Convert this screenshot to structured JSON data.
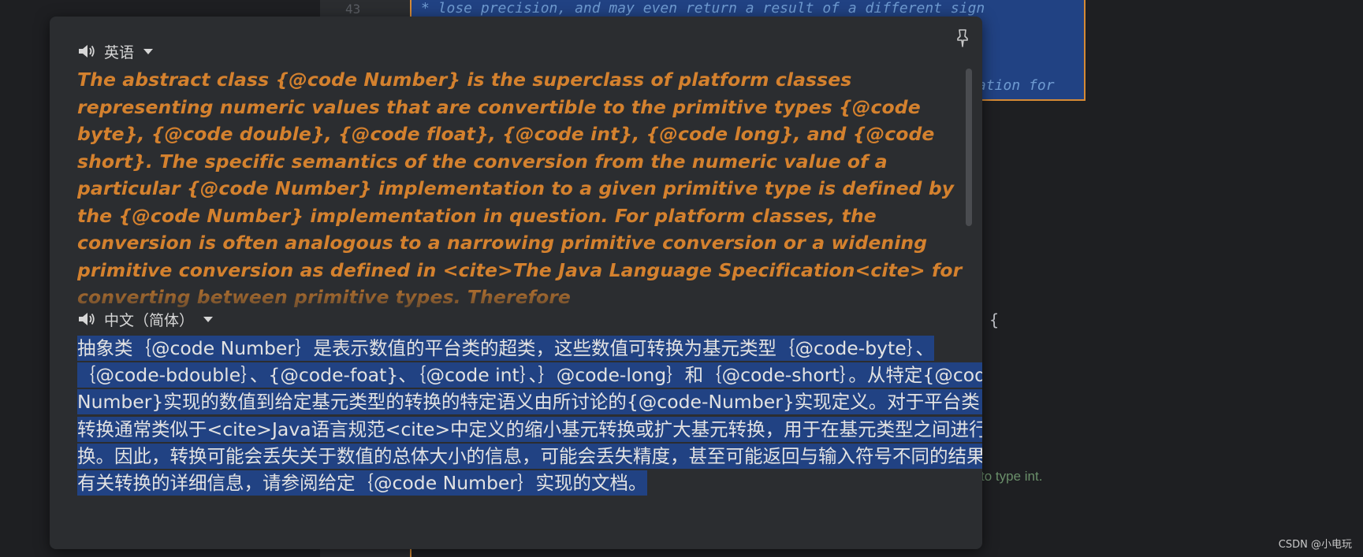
{
  "editor": {
    "line_number": "43",
    "code_lines": [
      "* lose precision, and may even return a result of a different sign",
      "ation for"
    ],
    "brace": "{",
    "hint": "to type int."
  },
  "popup": {
    "source": {
      "language": "英语",
      "text": "The abstract class {@code Number} is the superclass of platform classes representing numeric values that are convertible to the primitive types {@code byte}, {@code double}, {@code float}, {@code int}, {@code long}, and {@code short}. The specific semantics of the conversion from the numeric value of a particular {@code Number} implementation to a given primitive type is defined by the {@code Number} implementation in question. For platform classes, the conversion is often analogous to a narrowing primitive conversion or a widening primitive conversion as defined in <cite>The Java Language Specification<cite> for converting between primitive types. Therefore"
    },
    "target": {
      "language": "中文（简体）",
      "text": "抽象类｛@code Number｝是表示数值的平台类的超类，这些数值可转换为基元类型｛@code-byte｝、｛@code-bdouble｝、{@code-foat}、｛@code int｝、｝@code-long｝和｛@code-short｝。从特定{@code-Number}实现的数值到给定基元类型的转换的特定语义由所讨论的{@code-Number}实现定义。对于平台类，转换通常类似于<cite>Java语言规范<cite>中定义的缩小基元转换或扩大基元转换，用于在基元类型之间进行转换。因此，转换可能会丢失关于数值的总体大小的信息，可能会丢失精度，甚至可能返回与输入符号不同的结果。有关转换的详细信息，请参阅给定｛@code Number｝实现的文档。"
    }
  },
  "watermark": "CSDN @小电玩",
  "colors": {
    "source_text": "#d4812e",
    "selection": "#214283",
    "popup_bg": "#2b2d30",
    "accent_border": "#d58a35"
  },
  "icons": [
    "speaker-icon",
    "chevron-down-icon",
    "pin-icon"
  ]
}
